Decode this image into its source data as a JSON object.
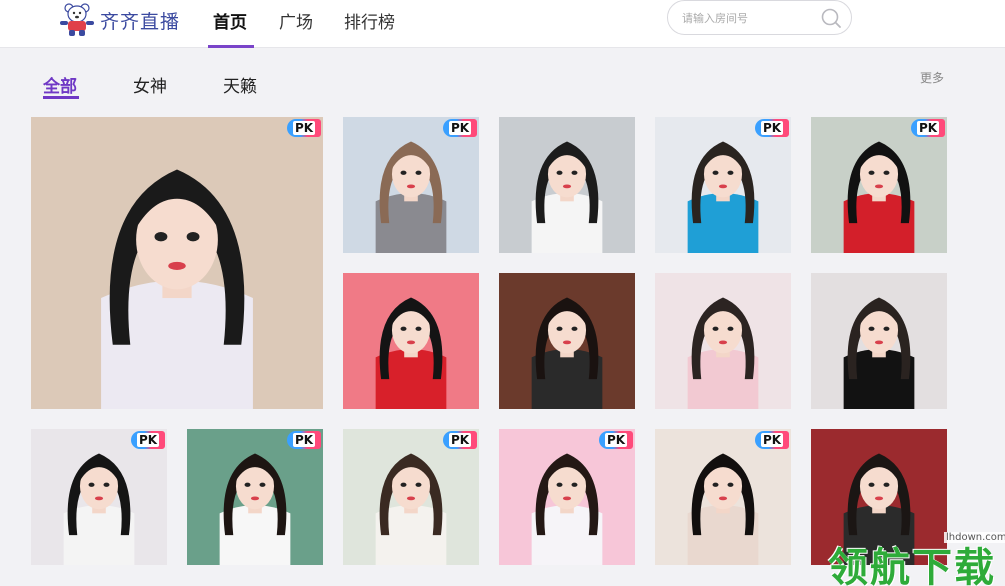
{
  "header": {
    "logo_text": "齐齐直播",
    "nav": [
      {
        "label": "首页",
        "active": true
      },
      {
        "label": "广场",
        "active": false
      },
      {
        "label": "排行榜",
        "active": false
      }
    ],
    "search": {
      "placeholder": "请输入房间号",
      "icon": "search-icon"
    }
  },
  "categories": {
    "tabs": [
      {
        "label": "全部",
        "active": true
      },
      {
        "label": "女神",
        "active": false
      },
      {
        "label": "天籁",
        "active": false
      }
    ],
    "more_label": "更多"
  },
  "streams": {
    "badge_label": "PK",
    "cards": [
      {
        "pk": true,
        "bg": "#dcc9b8",
        "hair": "#1a1a1a",
        "shirt": "#ece9f2"
      },
      {
        "pk": true,
        "bg": "#cfd9e4",
        "hair": "#8a6a55",
        "shirt": "#8a8a90"
      },
      {
        "pk": false,
        "bg": "#c8ccd0",
        "hair": "#1c1c1c",
        "shirt": "#f5f5f5"
      },
      {
        "pk": true,
        "bg": "#e6e9ee",
        "hair": "#2a2420",
        "shirt": "#1f9fd6"
      },
      {
        "pk": true,
        "bg": "#c8d0c8",
        "hair": "#111111",
        "shirt": "#d31f2a"
      },
      {
        "pk": false,
        "bg": "#f07a86",
        "hair": "#141414",
        "shirt": "#d8202a"
      },
      {
        "pk": false,
        "bg": "#6b3a2c",
        "hair": "#1a1210",
        "shirt": "#2a2a2a"
      },
      {
        "pk": false,
        "bg": "#efe3e6",
        "hair": "#2c2422",
        "shirt": "#f2c9d2"
      },
      {
        "pk": false,
        "bg": "#e3dfe0",
        "hair": "#2a2320",
        "shirt": "#121212"
      },
      {
        "pk": true,
        "bg": "#e9e6ea",
        "hair": "#151515",
        "shirt": "#f4f4f4"
      },
      {
        "pk": true,
        "bg": "#6aa08a",
        "hair": "#1d1512",
        "shirt": "#f7f7f7"
      },
      {
        "pk": true,
        "bg": "#dfe5dc",
        "hair": "#3a2a22",
        "shirt": "#f4f2ee"
      },
      {
        "pk": true,
        "bg": "#f7c6d8",
        "hair": "#241815",
        "shirt": "#f6f4f8"
      },
      {
        "pk": true,
        "bg": "#ece3dc",
        "hair": "#120f0e",
        "shirt": "#e9d8cf"
      },
      {
        "pk": false,
        "bg": "#9b2a2e",
        "hair": "#1b1614",
        "shirt": "#2b2b2b"
      }
    ]
  },
  "watermark": {
    "text": "领航下载",
    "domain": "lhdown.com"
  },
  "colors": {
    "accent": "#6f38c5",
    "logo": "#3b4aa0",
    "page_bg": "#f2f2f5"
  }
}
